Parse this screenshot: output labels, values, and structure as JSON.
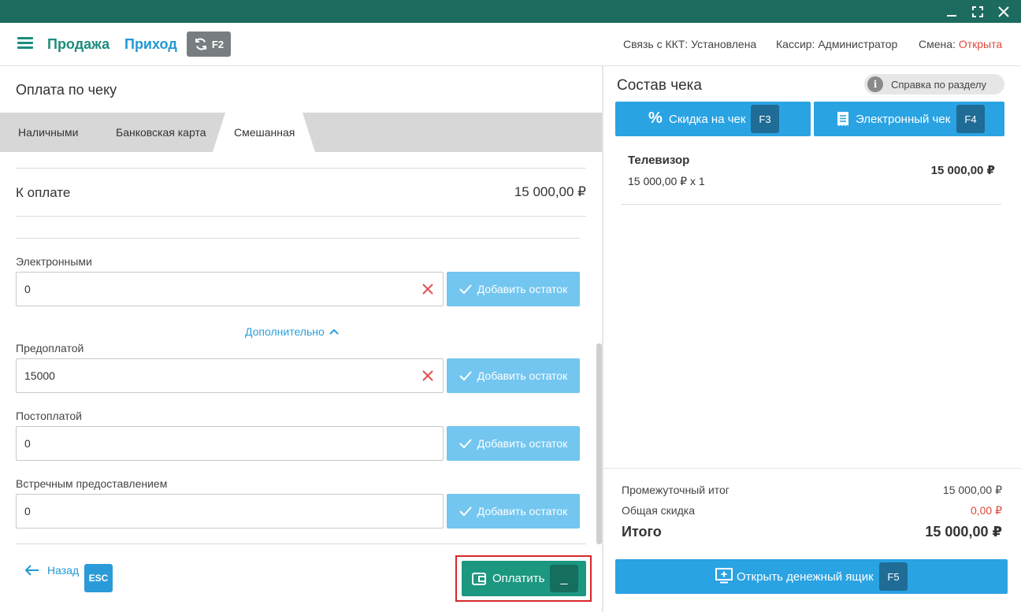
{
  "header": {
    "nav_sale": "Продажа",
    "nav_income": "Приход",
    "switch_key": "F2",
    "kkt_status": "Связь с ККТ: Установлена",
    "cashier": "Кассир: Администратор",
    "shift_label": "Смена:",
    "shift_value": "Открыта",
    "colors": {
      "titlebar": "#1c6b5e",
      "accent_green": "#1c8d7c",
      "accent_blue": "#2198d6",
      "status_red": "#e0493a"
    }
  },
  "payment": {
    "title": "Оплата по чеку",
    "tabs": [
      {
        "label": "Наличными",
        "active": false
      },
      {
        "label": "Банковская карта",
        "active": false
      },
      {
        "label": "Смешанная",
        "active": true
      }
    ],
    "to_pay_label": "К оплате",
    "to_pay_amount": "15 000,00 ₽",
    "more_link": "Дополнительно",
    "fields": [
      {
        "label": "Электронными",
        "value": "0",
        "clearable": true,
        "add_label": "Добавить остаток"
      },
      {
        "label": "Предоплатой",
        "value": "15000",
        "clearable": true,
        "add_label": "Добавить остаток"
      },
      {
        "label": "Постоплатой",
        "value": "0",
        "clearable": false,
        "add_label": "Добавить остаток"
      },
      {
        "label": "Встречным предоставлением",
        "value": "0",
        "clearable": false,
        "add_label": "Добавить остаток"
      }
    ],
    "back_label": "Назад",
    "back_key": "ESC",
    "pay_label": "Оплатить",
    "pay_key": "_"
  },
  "receipt": {
    "title": "Состав чека",
    "help_label": "Справка по разделу",
    "discount_label": "Скидка на чек",
    "discount_key": "F3",
    "ereceipt_label": "Электронный чек",
    "ereceipt_key": "F4",
    "items": [
      {
        "name": "Телевизор",
        "qty_line": "15 000,00 ₽ x 1",
        "sum": "15 000,00 ₽"
      }
    ],
    "subtotal_label": "Промежуточный итог",
    "subtotal_value": "15 000,00 ₽",
    "discount_total_label": "Общая скидка",
    "discount_total_value": "0,00 ₽",
    "total_label": "Итого",
    "total_value": "15 000,00 ₽",
    "drawer_label": "Открыть денежный ящик",
    "drawer_key": "F5"
  }
}
